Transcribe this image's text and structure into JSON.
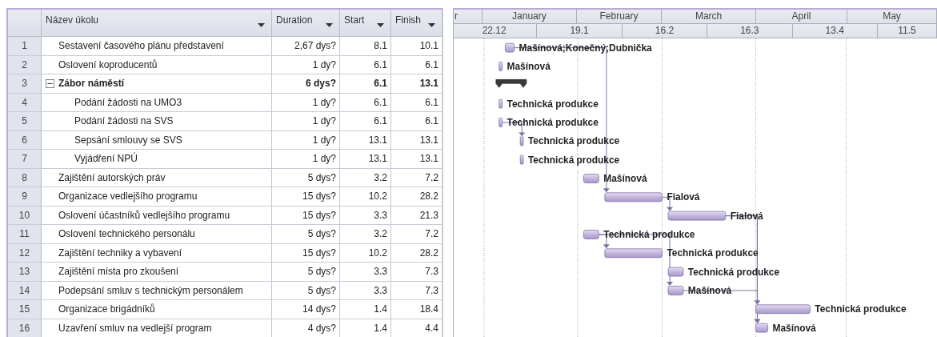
{
  "table": {
    "columns": [
      {
        "label": "Název úkolu",
        "menu": true
      },
      {
        "label": "Duration",
        "menu": true
      },
      {
        "label": "Start",
        "menu": true
      },
      {
        "label": "Finish",
        "menu": true
      }
    ]
  },
  "timescale": {
    "months": [
      "r",
      "January",
      "February",
      "March",
      "April",
      "May"
    ],
    "weeks": [
      "22.12",
      "19.1",
      "16.2",
      "16.3",
      "13.4",
      "11.5"
    ]
  },
  "tasks": [
    {
      "id": "1",
      "kind": "task",
      "name": "Sestavení  časového plánu představení",
      "duration": "2,67 dys?",
      "start": "8.1",
      "finish": "10.1",
      "resources": "Mašínová;Konečný;Dubnička"
    },
    {
      "id": "2",
      "kind": "task",
      "name": "Oslovení koproducentů",
      "duration": "1 dy?",
      "start": "6.1",
      "finish": "6.1",
      "resources": "Mašínová"
    },
    {
      "id": "3",
      "kind": "summary",
      "expanded": true,
      "name": "Zábor náměstí",
      "duration": "6 dys?",
      "start": "6.1",
      "finish": "13.1",
      "children": [
        {
          "id": "4",
          "kind": "task",
          "name": "Podání žádosti na UMO3",
          "duration": "1 dy?",
          "start": "6.1",
          "finish": "6.1",
          "resources": "Technická produkce"
        },
        {
          "id": "5",
          "kind": "task",
          "name": "Podání žádosti na SVS",
          "duration": "1 dy?",
          "start": "6.1",
          "finish": "6.1",
          "resources": "Technická produkce"
        },
        {
          "id": "6",
          "kind": "task",
          "name": "Sepsání smlouvy se SVS",
          "duration": "1 dy?",
          "start": "13.1",
          "finish": "13.1",
          "resources": "Technická produkce"
        },
        {
          "id": "7",
          "kind": "task",
          "name": "Vyjádření NPÚ",
          "duration": "1 dy?",
          "start": "13.1",
          "finish": "13.1",
          "resources": "Technická produkce"
        }
      ]
    },
    {
      "id": "8",
      "kind": "task",
      "name": "Zajištění autorských práv",
      "duration": "5 dys?",
      "start": "3.2",
      "finish": "7.2",
      "resources": "Mašínová"
    },
    {
      "id": "9",
      "kind": "task",
      "name": "Organizace vedlejšího programu",
      "duration": "15 dys?",
      "start": "10.2",
      "finish": "28.2",
      "resources": "Fialová"
    },
    {
      "id": "10",
      "kind": "task",
      "name": "Oslovení účastníků vedlejšího programu",
      "duration": "15 dys?",
      "start": "3.3",
      "finish": "21.3",
      "resources": "Fialová"
    },
    {
      "id": "11",
      "kind": "task",
      "name": "Oslovení technického personálu",
      "duration": "5 dys?",
      "start": "3.2",
      "finish": "7.2",
      "resources": "Technická produkce"
    },
    {
      "id": "12",
      "kind": "task",
      "name": "Zajištění techniky a vybavení",
      "duration": "15 dys?",
      "start": "10.2",
      "finish": "28.2",
      "resources": "Technická produkce"
    },
    {
      "id": "13",
      "kind": "task",
      "name": "Zajištění místa pro zkoušení",
      "duration": "5 dys?",
      "start": "3.3",
      "finish": "7.3",
      "resources": "Technická produkce"
    },
    {
      "id": "14",
      "kind": "task",
      "name": "Podepsání smluv s technickým personálem",
      "duration": "5 dys?",
      "start": "3.3",
      "finish": "7.3",
      "resources": "Mašínová"
    },
    {
      "id": "15",
      "kind": "task",
      "name": "Organizace brigádníků",
      "duration": "14 dys?",
      "start": "1.4",
      "finish": "18.4",
      "resources": "Technická produkce"
    },
    {
      "id": "16",
      "kind": "task",
      "name": "Uzavření smluv na vedlejší program",
      "duration": "4 dys?",
      "start": "1.4",
      "finish": "4.4",
      "resources": "Mašínová"
    }
  ]
}
